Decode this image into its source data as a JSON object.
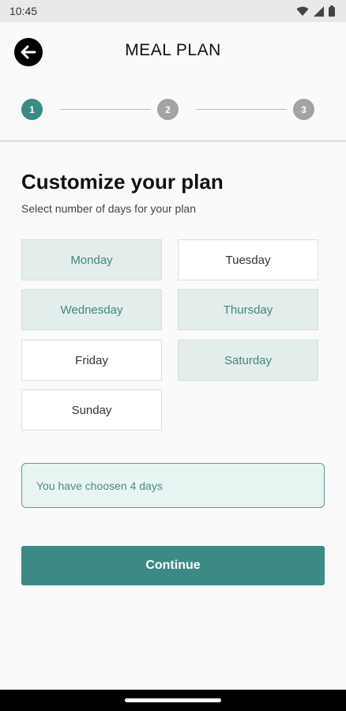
{
  "status_bar": {
    "time": "10:45"
  },
  "header": {
    "title": "MEAL PLAN",
    "steps": [
      "1",
      "2",
      "3"
    ]
  },
  "main": {
    "heading": "Customize your plan",
    "subheading": "Select number of days for your plan",
    "days": [
      {
        "label": "Monday",
        "selected": true
      },
      {
        "label": "Tuesday",
        "selected": false
      },
      {
        "label": "Wednesday",
        "selected": true
      },
      {
        "label": "Thursday",
        "selected": true
      },
      {
        "label": "Friday",
        "selected": false
      },
      {
        "label": "Saturday",
        "selected": true
      },
      {
        "label": "Sunday",
        "selected": false
      }
    ],
    "summary": "You have choosen 4 days",
    "continue_label": "Continue"
  },
  "colors": {
    "accent": "#3c8a86",
    "selected_bg": "#e3eeec",
    "summary_bg": "#e8f4f2"
  }
}
